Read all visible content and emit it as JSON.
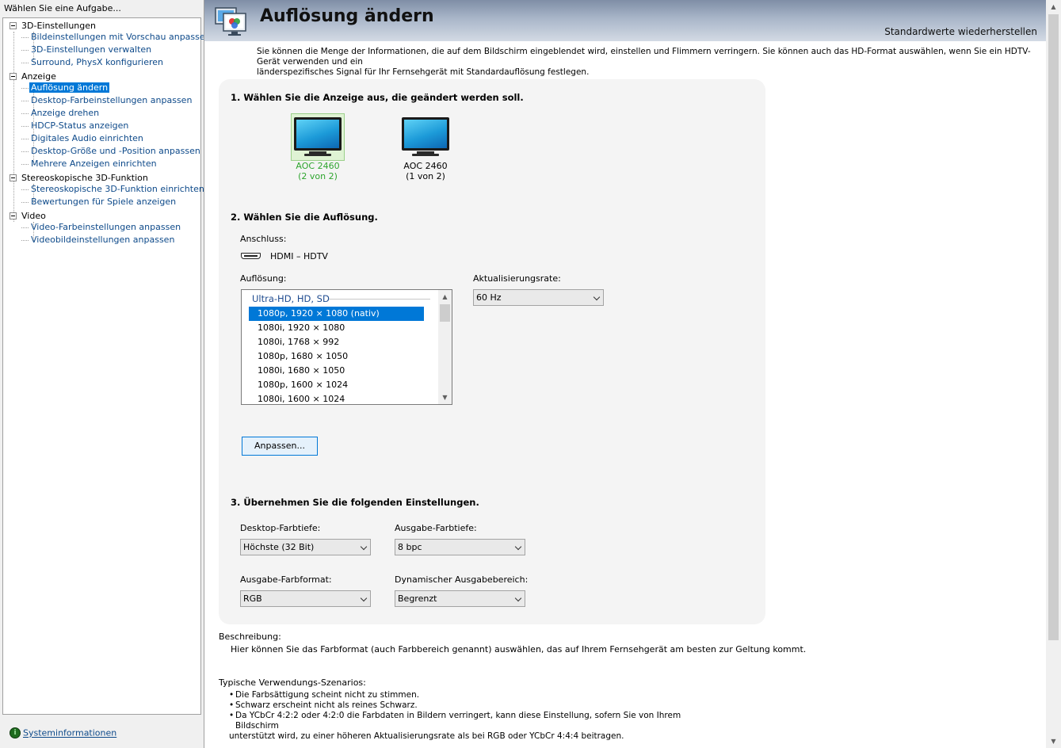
{
  "sidebar": {
    "header": "Wählen Sie eine Aufgabe...",
    "categories": [
      {
        "label": "3D-Einstellungen",
        "items": [
          "Bildeinstellungen mit Vorschau anpassen",
          "3D-Einstellungen verwalten",
          "Surround, PhysX konfigurieren"
        ]
      },
      {
        "label": "Anzeige",
        "items": [
          "Auflösung ändern",
          "Desktop-Farbeinstellungen anpassen",
          "Anzeige drehen",
          "HDCP-Status anzeigen",
          "Digitales Audio einrichten",
          "Desktop-Größe und -Position anpassen",
          "Mehrere Anzeigen einrichten"
        ]
      },
      {
        "label": "Stereoskopische 3D-Funktion",
        "items": [
          "Stereoskopische 3D-Funktion einrichten",
          "Bewertungen für Spiele anzeigen"
        ]
      },
      {
        "label": "Video",
        "items": [
          "Video-Farbeinstellungen anpassen",
          "Videobildeinstellungen anpassen"
        ]
      }
    ],
    "selected_item": "Auflösung ändern",
    "system_info": "Systeminformationen"
  },
  "page": {
    "title": "Auflösung ändern",
    "restore_defaults": "Standardwerte wiederherstellen",
    "intro_line1": "Sie können die Menge der Informationen, die auf dem Bildschirm eingeblendet wird, einstellen und Flimmern verringern. Sie können auch das HD-Format auswählen, wenn Sie ein HDTV-Gerät verwenden und ein",
    "intro_line2": "länderspezifisches Signal für Ihr Fernsehgerät mit Standardauflösung festlegen."
  },
  "section1": {
    "title": "1. Wählen Sie die Anzeige aus, die geändert werden soll.",
    "displays": [
      {
        "name": "AOC 2460",
        "index": "(2 von 2)",
        "selected": true
      },
      {
        "name": "AOC 2460",
        "index": "(1 von 2)",
        "selected": false
      }
    ]
  },
  "section2": {
    "title": "2. Wählen Sie die Auflösung.",
    "connection_label": "Anschluss:",
    "connection_value": "HDMI – HDTV",
    "resolution_label": "Auflösung:",
    "resolution_group": "Ultra-HD, HD, SD",
    "resolutions": [
      "1080p, 1920 × 1080 (nativ)",
      "1080i, 1920 × 1080",
      "1080i, 1768 × 992",
      "1080p, 1680 × 1050",
      "1080i, 1680 × 1050",
      "1080p, 1600 × 1024",
      "1080i, 1600 × 1024"
    ],
    "selected_resolution": "1080p, 1920 × 1080 (nativ)",
    "refresh_label": "Aktualisierungsrate:",
    "refresh_value": "60 Hz",
    "customize_button": "Anpassen..."
  },
  "section3": {
    "title": "3. Übernehmen Sie die folgenden Einstellungen.",
    "desktop_depth_label": "Desktop-Farbtiefe:",
    "desktop_depth_value": "Höchste (32 Bit)",
    "output_depth_label": "Ausgabe-Farbtiefe:",
    "output_depth_value": "8 bpc",
    "output_format_label": "Ausgabe-Farbformat:",
    "output_format_value": "RGB",
    "dynamic_range_label": "Dynamischer Ausgabebereich:",
    "dynamic_range_value": "Begrenzt"
  },
  "description": {
    "label": "Beschreibung:",
    "text": "Hier können Sie das Farbformat (auch Farbbereich genannt) auswählen, das auf Ihrem Fernsehgerät am besten zur Geltung kommt."
  },
  "usage": {
    "label": "Typische Verwendungs-Szenarios:",
    "bullet": "•",
    "items": [
      "Die Farbsättigung scheint nicht zu stimmen.",
      "Schwarz erscheint nicht als reines Schwarz.",
      "Da YCbCr 4:2:2 oder 4:2:0 die Farbdaten in Bildern verringert, kann diese Einstellung, sofern Sie von Ihrem Bildschirm"
    ],
    "item3_cont": "unterstützt wird, zu einer höheren Aktualisierungsrate als bei RGB oder YCbCr 4:4:4 beitragen."
  },
  "colors": {
    "selection": "#0078d7",
    "link": "#0e4a8a",
    "selected_display": "#2ea52e"
  }
}
